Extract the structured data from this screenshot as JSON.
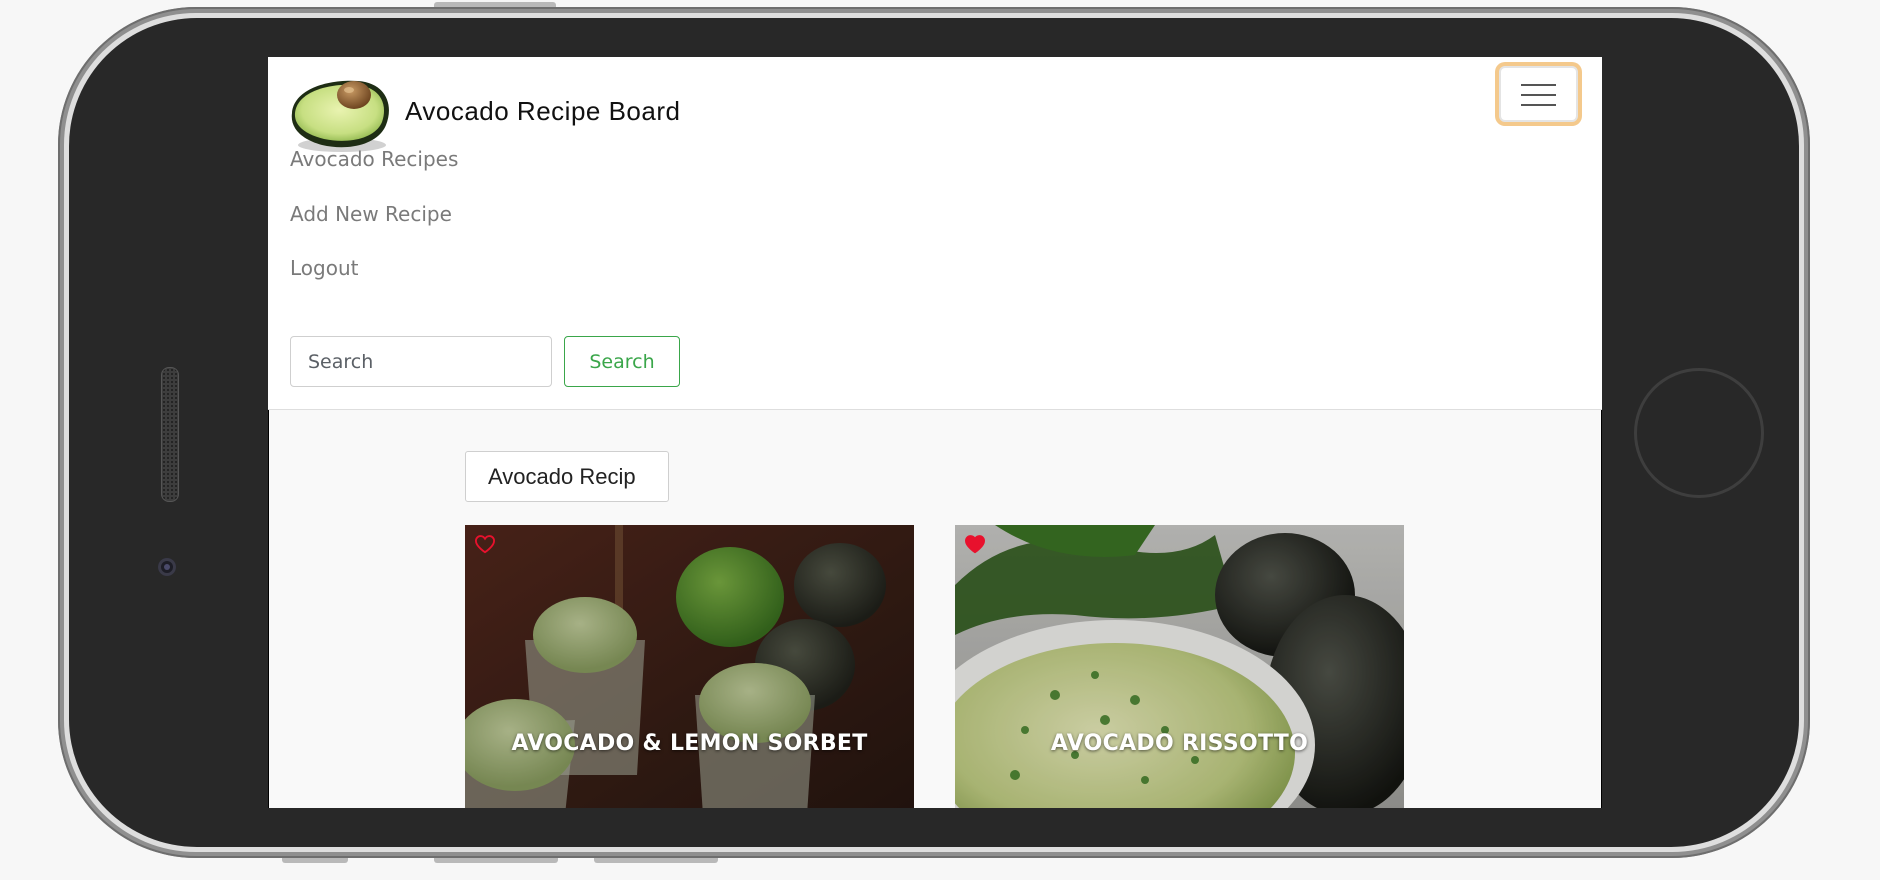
{
  "app": {
    "brand_name": "Avocado Recipe Board"
  },
  "nav": {
    "links": [
      {
        "label": "Avocado Recipes"
      },
      {
        "label": "Add New Recipe"
      },
      {
        "label": "Logout"
      }
    ],
    "search": {
      "placeholder": "Search",
      "button_label": "Search"
    },
    "toggler_icon": "hamburger-menu-icon"
  },
  "filter": {
    "value": "Avocado Recip"
  },
  "recipes": [
    {
      "title": "AVOCADO & LEMON SORBET",
      "favorited": false
    },
    {
      "title": "AVOCADO RISSOTTO",
      "favorited": true
    }
  ],
  "colors": {
    "accent_green": "#3aa64a",
    "heart_red": "#e8112d",
    "focus_ring": "#f4c98c"
  }
}
